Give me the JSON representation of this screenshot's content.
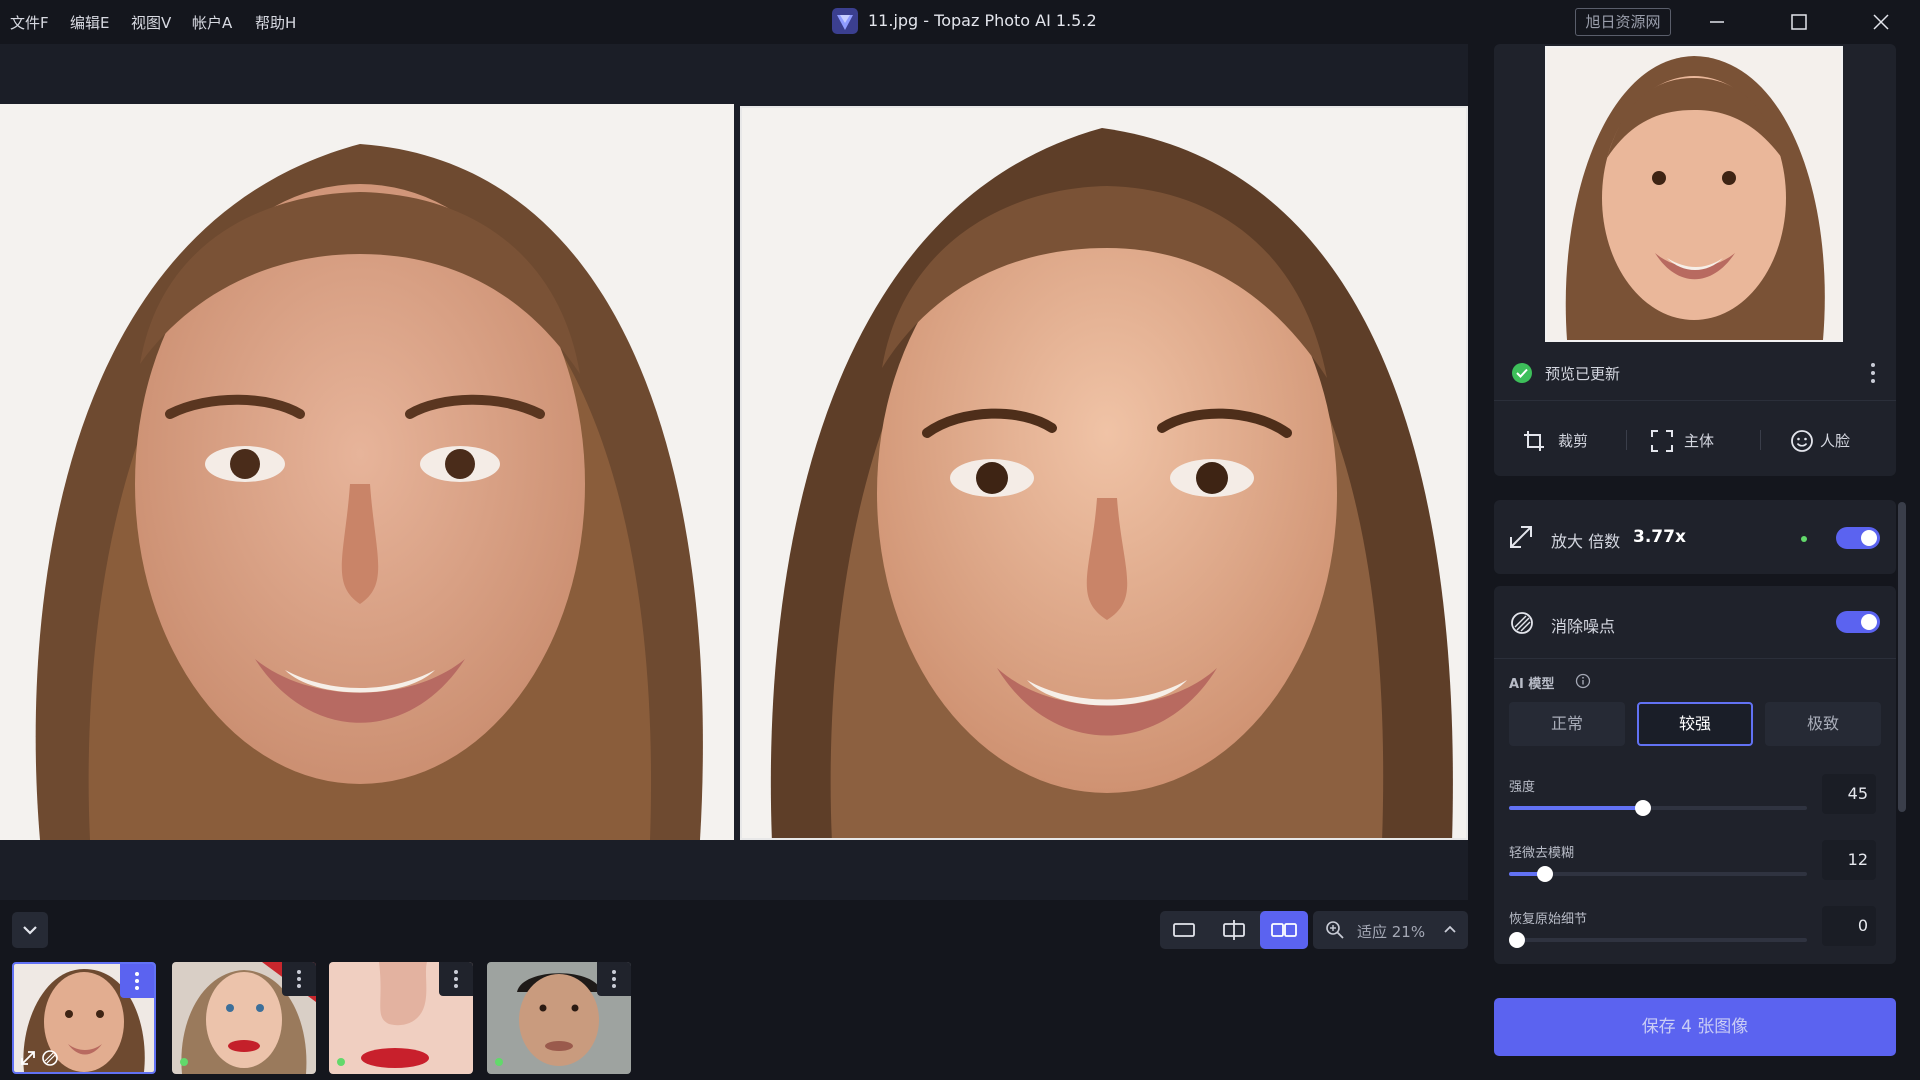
{
  "menu": [
    "文件F",
    "编辑E",
    "视图V",
    "帐户A",
    "帮助H"
  ],
  "window": {
    "title": "11.jpg - Topaz Photo AI 1.5.2",
    "resource_button": "旭日资源网"
  },
  "preview": {
    "status": "预览已更新",
    "tools": [
      {
        "icon": "crop-icon",
        "label": "裁剪"
      },
      {
        "icon": "subject-icon",
        "label": "主体"
      },
      {
        "icon": "face-icon",
        "label": "人脸"
      }
    ]
  },
  "upscale": {
    "label": "放大 倍数",
    "value": "3.77x",
    "enabled": true
  },
  "denoise": {
    "label": "消除噪点",
    "enabled": true,
    "model_label": "AI 模型",
    "models": [
      {
        "label": "正常"
      },
      {
        "label": "较强"
      },
      {
        "label": "极致"
      }
    ],
    "active_model": "较强",
    "sliders": [
      {
        "label": "强度",
        "value": 45,
        "display": "45",
        "max": 100
      },
      {
        "label": "轻微去模糊",
        "value": 12,
        "display": "12",
        "max": 100
      },
      {
        "label": "恢复原始细节",
        "value": 0,
        "display": "0",
        "max": 100
      }
    ]
  },
  "zoom": {
    "label": "适应 21%"
  },
  "save_button": "保存 4 张图像",
  "colors": {
    "accent": "#5b63f0",
    "status_green": "#62d96b",
    "bg": "#14161d"
  }
}
